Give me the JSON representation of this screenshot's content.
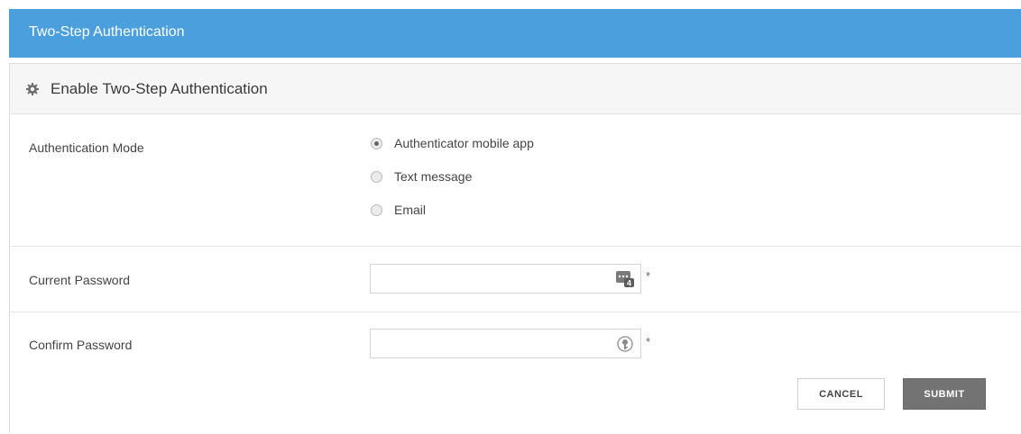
{
  "header": {
    "title": "Two-Step Authentication"
  },
  "panel": {
    "title": "Enable Two-Step Authentication",
    "icon": "gear-icon"
  },
  "auth_mode": {
    "label": "Authentication Mode",
    "options": [
      {
        "label": "Authenticator mobile app",
        "checked": true
      },
      {
        "label": "Text message",
        "checked": false
      },
      {
        "label": "Email",
        "checked": false
      }
    ]
  },
  "current_password": {
    "label": "Current Password",
    "value": "",
    "required_mark": "*",
    "icon": "password-manager-icon"
  },
  "confirm_password": {
    "label": "Confirm Password",
    "value": "",
    "required_mark": "*",
    "icon": "key-icon"
  },
  "actions": {
    "cancel_label": "CANCEL",
    "submit_label": "SUBMIT"
  },
  "colors": {
    "header_bg": "#4a9fdc",
    "submit_bg": "#737373"
  }
}
